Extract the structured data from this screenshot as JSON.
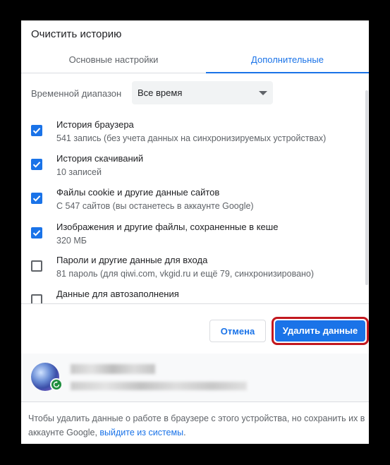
{
  "dialog": {
    "title": "Очистить историю",
    "tabs": [
      {
        "label": "Основные настройки",
        "active": false
      },
      {
        "label": "Дополнительные",
        "active": true
      }
    ]
  },
  "time_range": {
    "label": "Временной диапазон",
    "value": "Все время"
  },
  "items": [
    {
      "title": "История браузера",
      "subtitle": "541 запись (без учета данных на синхронизируемых устройствах)",
      "checked": true
    },
    {
      "title": "История скачиваний",
      "subtitle": "10 записей",
      "checked": true
    },
    {
      "title": "Файлы cookie и другие данные сайтов",
      "subtitle": "С 547 сайтов (вы останетесь в аккаунте Google)",
      "checked": true
    },
    {
      "title": "Изображения и другие файлы, сохраненные в кеше",
      "subtitle": "320 МБ",
      "checked": true
    },
    {
      "title": "Пароли и другие данные для входа",
      "subtitle": "81 пароль (для qiwi.com, vkgid.ru и ещё 79, синхронизировано)",
      "checked": false
    },
    {
      "title": "Данные для автозаполнения",
      "subtitle": "",
      "checked": false
    }
  ],
  "buttons": {
    "cancel": "Отмена",
    "delete": "Удалить данные"
  },
  "footer": {
    "text": "Чтобы удалить данные о работе в браузере с этого устройства, но сохранить их в аккаунте Google,",
    "link": "выйдите из системы",
    "end": "."
  },
  "colors": {
    "accent": "#1a73e8",
    "highlight": "#c2181f",
    "sync": "#1e8e3e"
  }
}
